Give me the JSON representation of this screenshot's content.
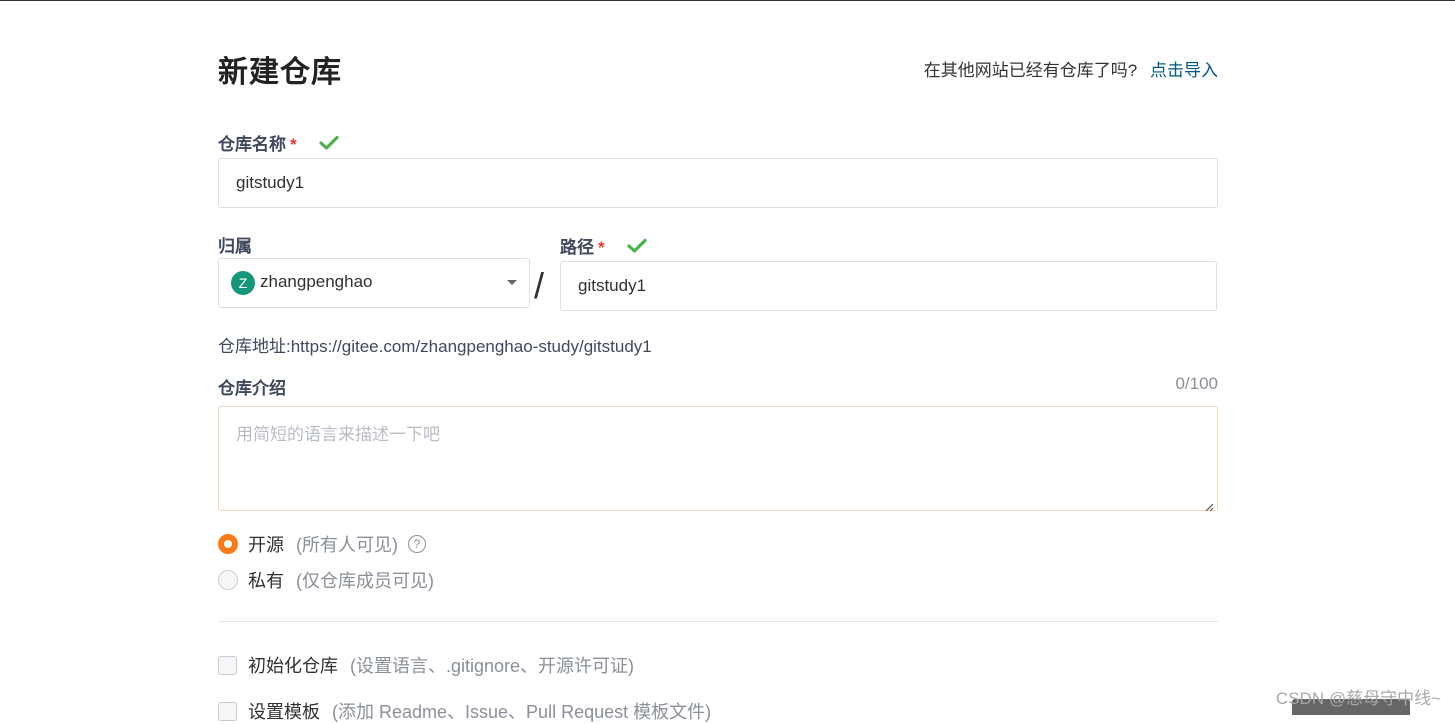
{
  "header": {
    "title": "新建仓库",
    "import_prompt": "在其他网站已经有仓库了吗?",
    "import_link": "点击导入"
  },
  "repo_name": {
    "label": "仓库名称",
    "required_mark": "*",
    "value": "gitstudy1"
  },
  "owner": {
    "label": "归属",
    "avatar_letter": "Z",
    "value": "zhangpenghao"
  },
  "separator": "/",
  "path": {
    "label": "路径",
    "required_mark": "*",
    "value": "gitstudy1"
  },
  "repo_address": {
    "text": "仓库地址:https://gitee.com/zhangpenghao-study/gitstudy1"
  },
  "description": {
    "label": "仓库介绍",
    "counter": "0/100",
    "placeholder": "用简短的语言来描述一下吧"
  },
  "visibility": {
    "options": [
      {
        "label": "开源",
        "note": "(所有人可见)",
        "selected": true
      },
      {
        "label": "私有",
        "note": "(仅仓库成员可见)",
        "selected": false
      }
    ],
    "help_icon": "question-circle-icon"
  },
  "init_options": [
    {
      "label": "初始化仓库",
      "note": "(设置语言、.gitignore、开源许可证)"
    },
    {
      "label": "设置模板",
      "note": "(添加 Readme、Issue、Pull Request 模板文件)"
    }
  ],
  "watermark": "CSDN @慈母守中线~",
  "colors": {
    "accent_orange": "#fa7a17",
    "link": "#005980",
    "check_green": "#4caf50",
    "required_red": "#e3392f",
    "avatar_bg": "#16967a"
  }
}
